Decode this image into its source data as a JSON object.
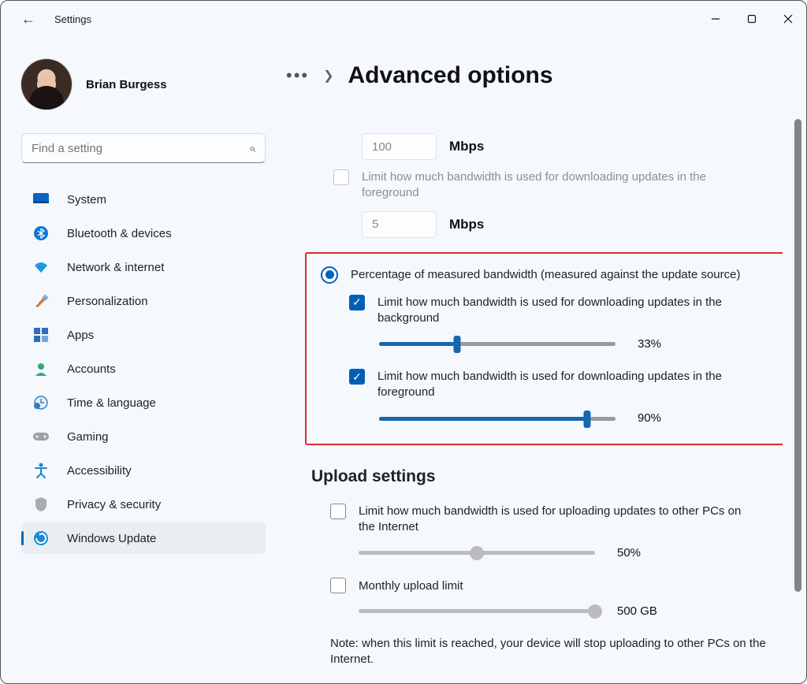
{
  "app_title": "Settings",
  "user": {
    "name": "Brian Burgess"
  },
  "search": {
    "placeholder": "Find a setting"
  },
  "sidebar": {
    "items": [
      {
        "label": "System"
      },
      {
        "label": "Bluetooth & devices"
      },
      {
        "label": "Network & internet"
      },
      {
        "label": "Personalization"
      },
      {
        "label": "Apps"
      },
      {
        "label": "Accounts"
      },
      {
        "label": "Time & language"
      },
      {
        "label": "Gaming"
      },
      {
        "label": "Accessibility"
      },
      {
        "label": "Privacy & security"
      },
      {
        "label": "Windows Update"
      }
    ]
  },
  "page": {
    "title": "Advanced options"
  },
  "absolute": {
    "bg_value": "100",
    "fg_label": "Limit how much bandwidth is used for downloading updates in the foreground",
    "fg_value": "5",
    "unit": "Mbps"
  },
  "percent": {
    "radio_label": "Percentage of measured bandwidth (measured against the update source)",
    "bg_label": "Limit how much bandwidth is used for downloading updates in the background",
    "bg_value": "33%",
    "bg_pct": 33,
    "fg_label": "Limit how much bandwidth is used for downloading updates in the foreground",
    "fg_value": "90%",
    "fg_pct": 88
  },
  "upload": {
    "heading": "Upload settings",
    "limit_label": "Limit how much bandwidth is used for uploading updates to other PCs on the Internet",
    "limit_value": "50%",
    "limit_pct": 50,
    "monthly_label": "Monthly upload limit",
    "monthly_value": "500 GB",
    "monthly_pct": 100,
    "note": "Note: when this limit is reached, your device will stop uploading to other PCs on the Internet."
  }
}
